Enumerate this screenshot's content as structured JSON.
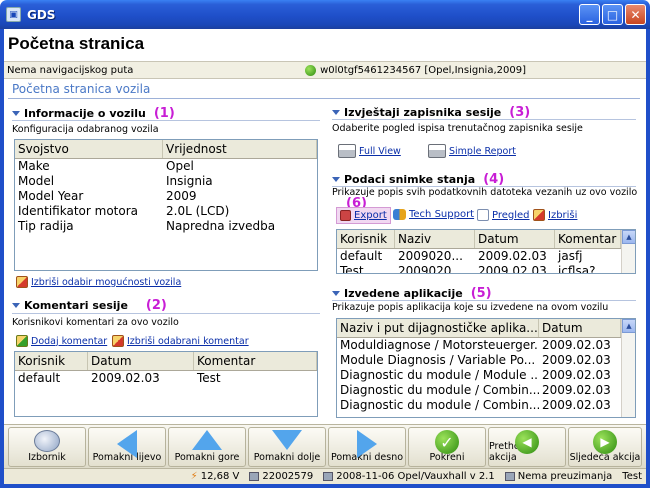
{
  "window": {
    "title": "GDS",
    "minimize": "_",
    "maximize": "□",
    "close": "✕"
  },
  "page_title": "Početna stranica",
  "nav": {
    "left": "Nema navigacijskog puta",
    "vehicle": "w0l0tgf5461234567 [Opel,Insignia,2009]"
  },
  "breadcrumb": "Početna stranica vozila",
  "vehicle_info": {
    "title": "Informacije o vozilu",
    "marker": "(1)",
    "subtitle": "Konfiguracija odabranog vozila",
    "columns": [
      "Svojstvo",
      "Vrijednost"
    ],
    "rows": [
      [
        "Make",
        "Opel"
      ],
      [
        "Model",
        "Insignia"
      ],
      [
        "Model Year",
        "2009"
      ],
      [
        "Identifikator motora",
        "2.0L (LCD)"
      ],
      [
        "Tip radija",
        "Napredna izvedba"
      ]
    ],
    "clear_link": "Izbriši odabir mogućnosti vozila"
  },
  "session_comments": {
    "title": "Komentari sesije",
    "marker": "(2)",
    "subtitle": "Korisnikovi komentari za ovo vozilo",
    "add_link": "Dodaj komentar",
    "delete_link": "Izbriši odabrani komentar",
    "columns": [
      "Korisnik",
      "Datum",
      "Komentar"
    ],
    "rows": [
      [
        "default",
        "2009.02.03",
        "Test"
      ]
    ]
  },
  "session_reports": {
    "title": "Izvještaji zapisnika sesije",
    "marker": "(3)",
    "subtitle": "Odaberite pogled ispisa trenutačnog zapisnika sesije",
    "full_view": "Full View",
    "simple_report": "Simple Report"
  },
  "snapshot_data": {
    "title": "Podaci snimke stanja",
    "marker": "(4)",
    "subtitle": "Prikazuje popis svih podatkovnih datoteka vezanih uz ovo vozilo",
    "export_marker": "(6)",
    "toolbar": {
      "export": "Export",
      "tech_support": "Tech Support",
      "preview": "Pregled",
      "delete": "Izbriši"
    },
    "columns": [
      "Korisnik",
      "Naziv",
      "Datum",
      "Komentar"
    ],
    "rows": [
      [
        "default",
        "2009020...",
        "2009.02.03",
        "jasfj"
      ],
      [
        "Test",
        "2009020...",
        "2009.02.03",
        "jcflsa?"
      ]
    ]
  },
  "applications": {
    "title": "Izvedene aplikacije",
    "marker": "(5)",
    "subtitle": "Prikazuje popis aplikacija koje su izvedene na ovom vozilu",
    "columns": [
      "Naziv i put dijagnostičke aplika...",
      "Datum"
    ],
    "rows": [
      [
        "Moduldiagnose / Motorsteuerger...",
        "2009.02.03"
      ],
      [
        "Module Diagnosis / Variable Po...",
        "2009.02.03"
      ],
      [
        "Diagnostic du module / Module ...",
        "2009.02.03"
      ],
      [
        "Diagnostic du module / Combin...",
        "2009.02.03"
      ],
      [
        "Diagnostic du module / Combin...",
        "2009.02.03"
      ]
    ]
  },
  "bottom_toolbar": {
    "menu": "Izbornik",
    "left": "Pomakni lijevo",
    "up": "Pomakni gore",
    "down": "Pomakni dolje",
    "right": "Pomakni desno",
    "run": "Pokreni",
    "prev": "Prethodna akcija",
    "next": "Sljedeća akcija"
  },
  "status": {
    "voltage": "12,68 V",
    "id": "22002579",
    "version": "2008-11-06 Opel/Vauxhall v 2.1",
    "download": "Nema preuzimanja",
    "mode": "Test"
  },
  "colors": {
    "accent": "#1f4fc9",
    "marker": "#c81ed5",
    "link": "#0a2ea8"
  }
}
